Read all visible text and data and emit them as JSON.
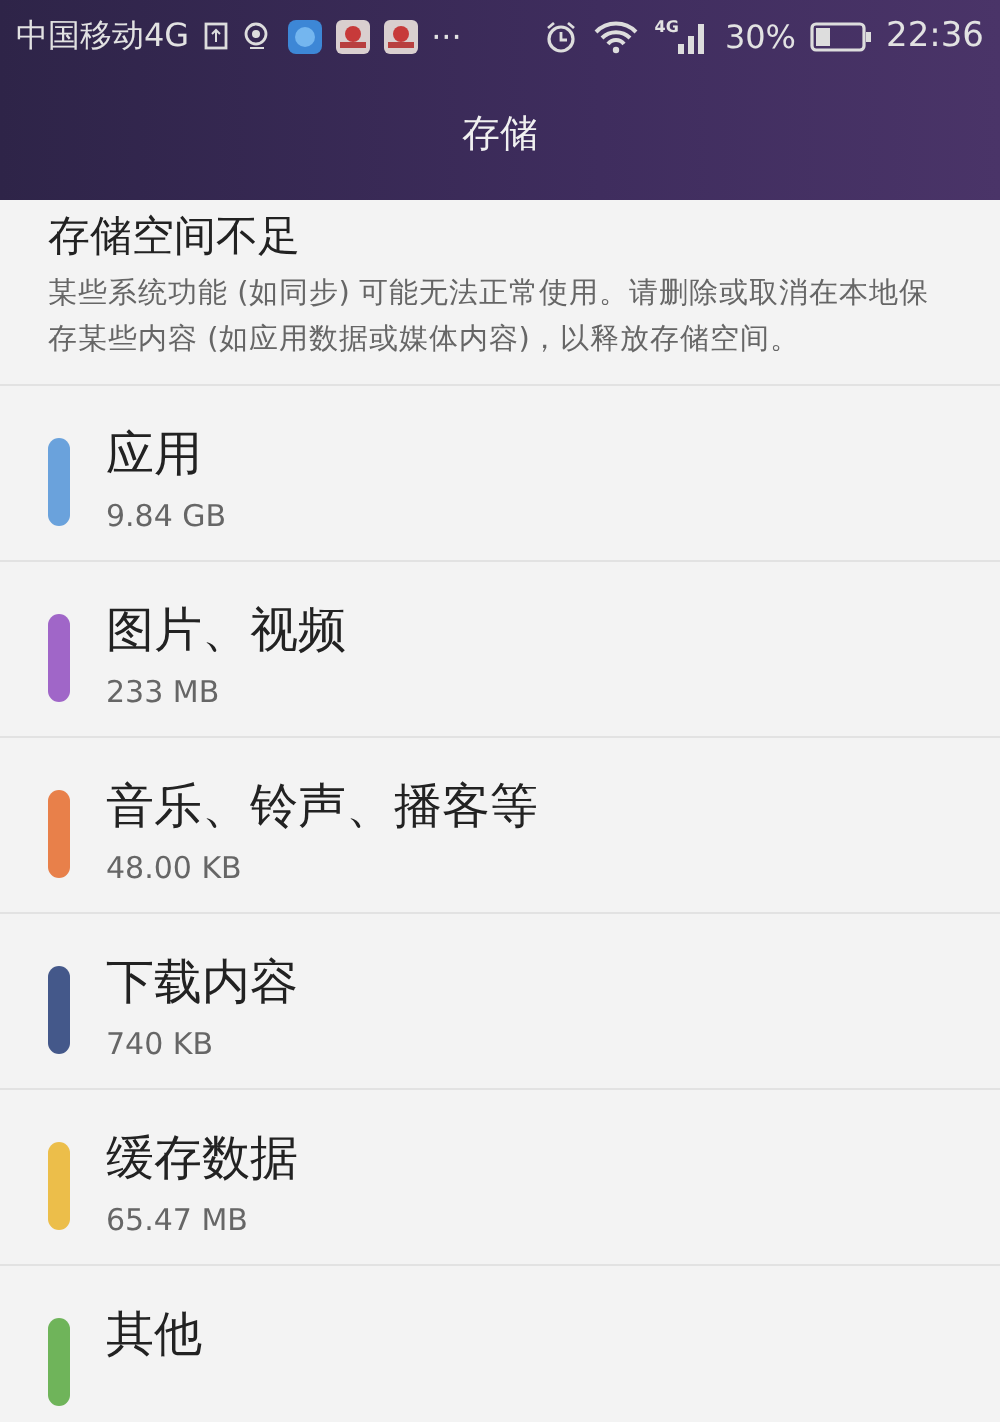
{
  "status_bar": {
    "carrier": "中国移动4G",
    "more": "···",
    "network": "4G",
    "battery": "30%",
    "time": "22:36"
  },
  "title_bar": {
    "title": "存储"
  },
  "warning": {
    "title": "存储空间不足",
    "message": "某些系统功能 (如同步) 可能无法正常使用。请删除或取消在本地保存某些内容 (如应用数据或媒体内容)，以释放存储空间。"
  },
  "categories": [
    {
      "name": "应用",
      "size": "9.84 GB",
      "color": "#6aa2dc"
    },
    {
      "name": "图片、视频",
      "size": "233 MB",
      "color": "#a066c8"
    },
    {
      "name": "音乐、铃声、播客等",
      "size": "48.00 KB",
      "color": "#e8804a"
    },
    {
      "name": "下载内容",
      "size": "740 KB",
      "color": "#44588a"
    },
    {
      "name": "缓存数据",
      "size": "65.47 MB",
      "color": "#ecbe4a"
    },
    {
      "name": "其他",
      "color": "#6fb45a"
    }
  ]
}
